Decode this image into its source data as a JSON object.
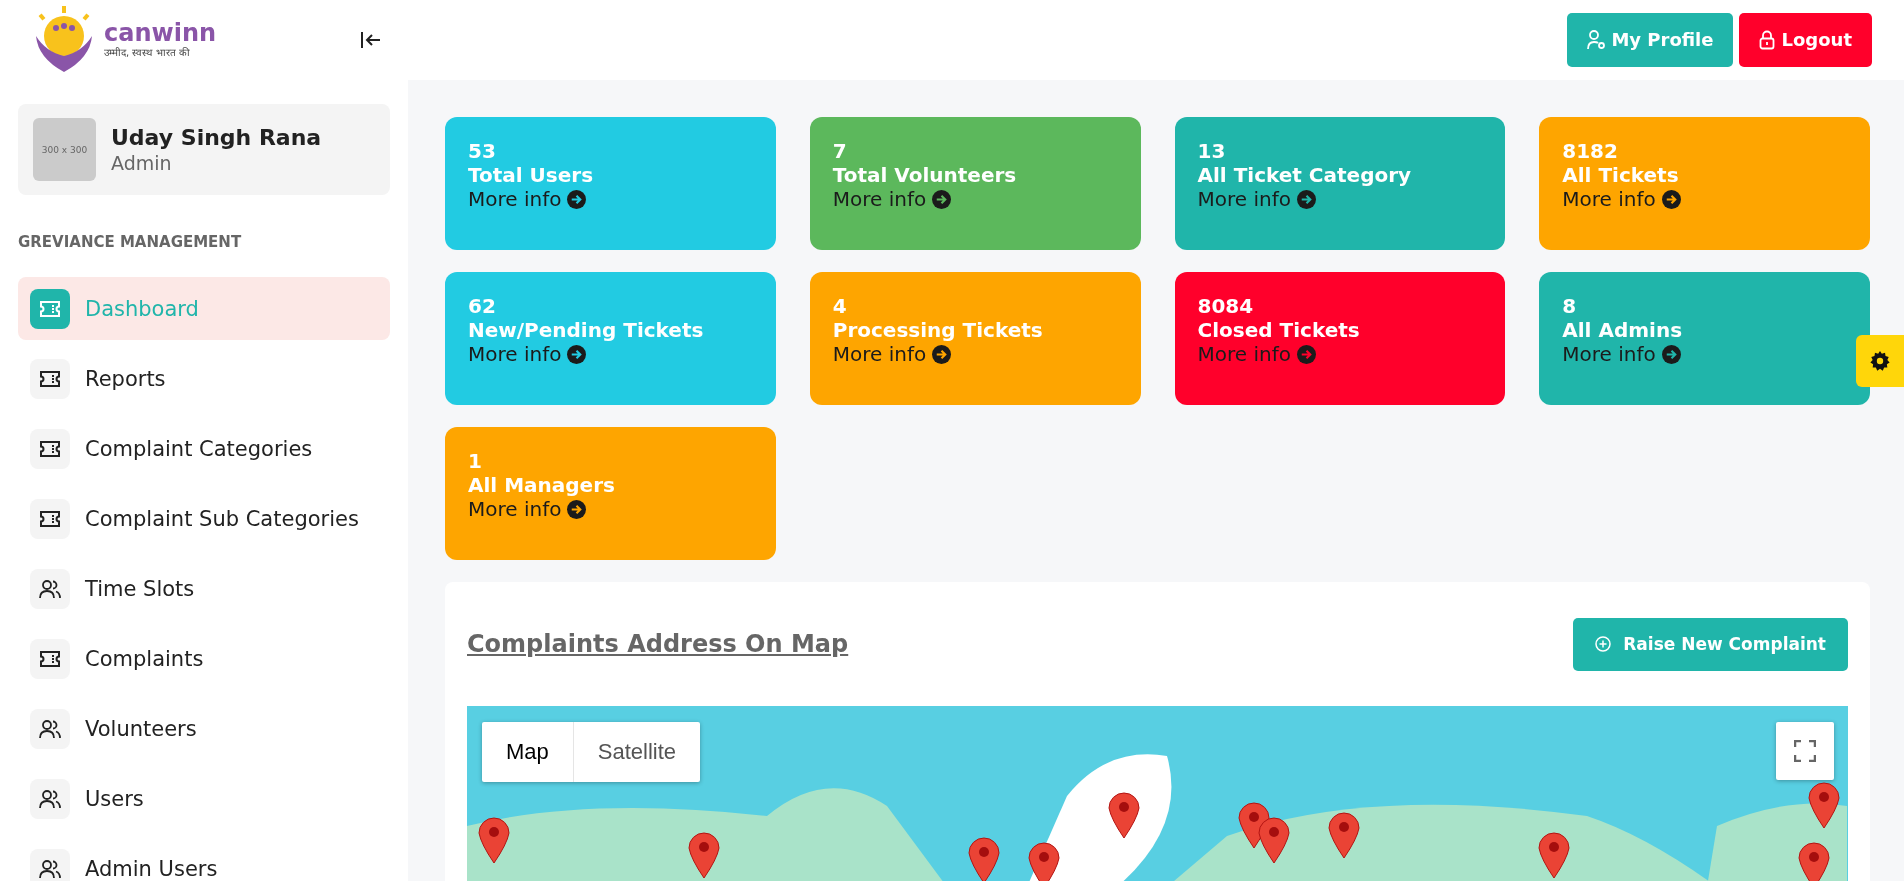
{
  "logo": {
    "name": "canwinn",
    "tagline": "उम्मीद, स्वस्थ भारत की"
  },
  "header": {
    "buttons": [
      {
        "label": "My Profile",
        "kind": "profile"
      },
      {
        "label": "Logout",
        "kind": "logout"
      }
    ]
  },
  "profile": {
    "name": "Uday Singh Rana",
    "role": "Admin",
    "avatar_text": "300 x 300"
  },
  "sidebar": {
    "section": "GREVIANCE MANAGEMENT",
    "items": [
      {
        "label": "Dashboard",
        "kind": "ticket",
        "selected": true
      },
      {
        "label": "Reports",
        "kind": "ticket",
        "selected": false
      },
      {
        "label": "Complaint Categories",
        "kind": "ticket",
        "selected": false
      },
      {
        "label": "Complaint Sub Categories",
        "kind": "ticket",
        "selected": false
      },
      {
        "label": "Time Slots",
        "kind": "users",
        "selected": false
      },
      {
        "label": "Complaints",
        "kind": "ticket",
        "selected": false
      },
      {
        "label": "Volunteers",
        "kind": "users",
        "selected": false
      },
      {
        "label": "Users",
        "kind": "users",
        "selected": false
      },
      {
        "label": "Admin Users",
        "kind": "users",
        "selected": false
      }
    ]
  },
  "stats": [
    {
      "count": "53",
      "title": "Total Users",
      "link": "More info",
      "color": "#22cbe2"
    },
    {
      "count": "7",
      "title": "Total Volunteers",
      "link": "More info",
      "color": "#5cb85c"
    },
    {
      "count": "13",
      "title": "All Ticket Category",
      "link": "More info",
      "color": "#20b5aa"
    },
    {
      "count": "8182",
      "title": "All Tickets",
      "link": "More info",
      "color": "#fea500"
    },
    {
      "count": "62",
      "title": "New/Pending Tickets",
      "link": "More info",
      "color": "#22cbe2"
    },
    {
      "count": "4",
      "title": "Processing Tickets",
      "link": "More info",
      "color": "#fea500"
    },
    {
      "count": "8084",
      "title": "Closed Tickets",
      "link": "More info",
      "color": "#ff002b"
    },
    {
      "count": "8",
      "title": "All Admins",
      "link": "More info",
      "color": "#20b5aa"
    },
    {
      "count": "1",
      "title": "All Managers",
      "link": "More info",
      "color": "#fea500"
    }
  ],
  "map_panel": {
    "title": "Complaints Address On Map",
    "button": "Raise New Complaint",
    "map_types": [
      {
        "label": "Map",
        "selected": true
      },
      {
        "label": "Satellite",
        "selected": false
      }
    ]
  }
}
